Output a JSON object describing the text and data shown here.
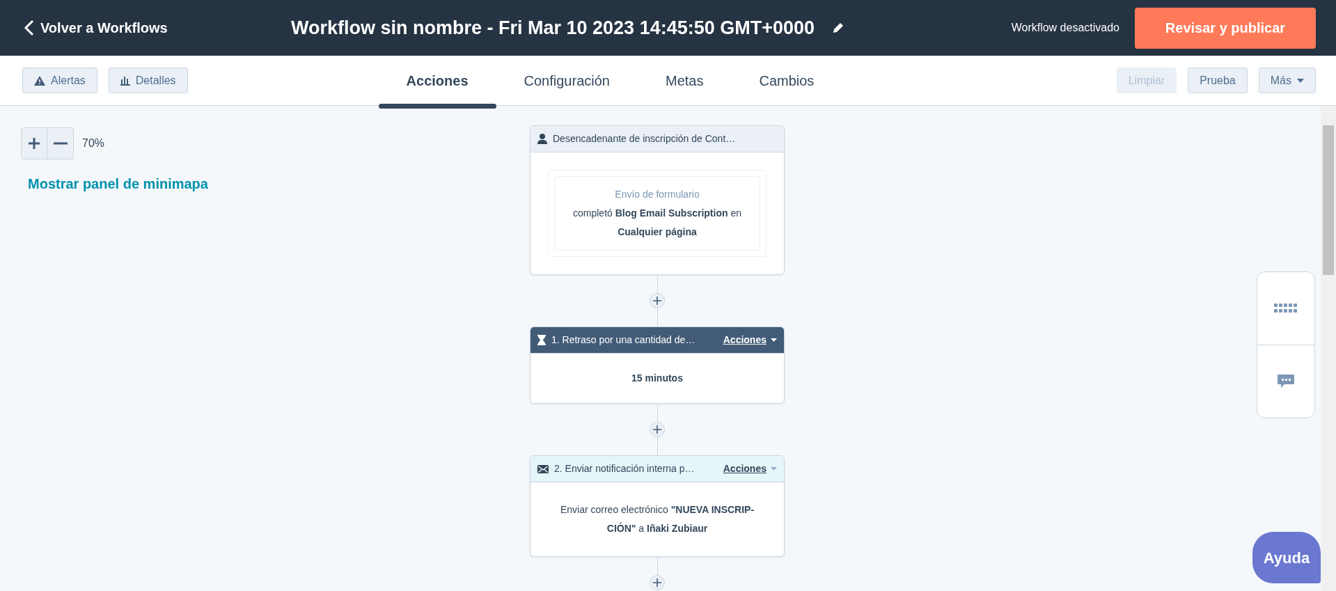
{
  "header": {
    "back_link": "Volver a Workflows",
    "title": "Workflow sin nombre - Fri Mar 10 2023 14:45:50 GMT+0000",
    "status": "Workflow desactivado",
    "publish_button": "Revisar y publicar"
  },
  "toolbar": {
    "left_buttons": [
      {
        "kind": "warning",
        "label": "Alertas"
      },
      {
        "kind": "chart",
        "label": "Detalles"
      }
    ],
    "tabs": [
      {
        "label": "Acciones",
        "selected": true
      },
      {
        "label": "Configuración",
        "selected": false
      },
      {
        "label": "Metas",
        "selected": false
      },
      {
        "label": "Cambios",
        "selected": false
      }
    ],
    "right_buttons": [
      {
        "label": "Limpiar",
        "disabled": true,
        "dropdown": false
      },
      {
        "label": "Prueba",
        "disabled": false,
        "dropdown": false
      },
      {
        "label": "Más",
        "disabled": false,
        "dropdown": true
      }
    ]
  },
  "canvas": {
    "zoom_level": "70%",
    "minimap_link": "Mostrar panel de minimapa",
    "steps": [
      {
        "kind": "trigger",
        "title": "Desencadenante de inscripción de Cont…",
        "subtitle": "Envío de formulario",
        "text": "completó **Blog Email Subscription** en **Cualquier página**"
      },
      {
        "kind": "delay",
        "title": "1. Retraso por una cantidad de…",
        "actions": "Acciones",
        "text": "15 minutos"
      },
      {
        "kind": "notification",
        "title": "2. Enviar notificación interna p…",
        "actions": "Acciones",
        "text": "Enviar correo electrónico **\"NUEVA INSCRIP-CIÓN\"** a **Iñaki Zubiaur**"
      }
    ]
  },
  "help_button": "Ayuda"
}
